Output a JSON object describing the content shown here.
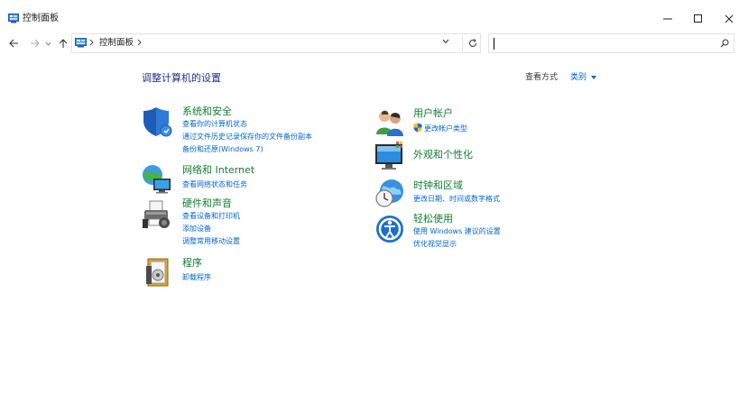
{
  "window": {
    "title": "控制面板"
  },
  "address": {
    "crumb": "控制面板"
  },
  "main": {
    "heading": "调整计算机的设置",
    "view_by_label": "查看方式",
    "view_by_value": "类别"
  },
  "left_categories": [
    {
      "title": "系统和安全",
      "icon": "shield-icon",
      "links": [
        "查看你的计算机状态",
        "通过文件历史记录保存你的文件备份副本",
        "备份和还原(Windows 7)"
      ]
    },
    {
      "title": "网络和 Internet",
      "icon": "network-globe-icon",
      "links": [
        "查看网络状态和任务"
      ]
    },
    {
      "title": "硬件和声音",
      "icon": "printer-speaker-icon",
      "links": [
        "查看设备和打印机",
        "添加设备",
        "调整常用移动设置"
      ]
    },
    {
      "title": "程序",
      "icon": "programs-icon",
      "links": [
        "卸载程序"
      ]
    }
  ],
  "right_categories": [
    {
      "title": "用户帐户",
      "icon": "users-icon",
      "links": [
        "更改帐户类型"
      ]
    },
    {
      "title": "外观和个性化",
      "icon": "monitor-palette-icon",
      "links": []
    },
    {
      "title": "时钟和区域",
      "icon": "clock-globe-icon",
      "links": [
        "更改日期、时间或数字格式"
      ]
    },
    {
      "title": "轻松使用",
      "icon": "ease-of-access-icon",
      "links": [
        "使用 Windows 建议的设置",
        "优化视觉显示"
      ]
    }
  ],
  "colors": {
    "category_title": "#0e7f2f",
    "link": "#0066cc",
    "heading": "#1e3287"
  }
}
